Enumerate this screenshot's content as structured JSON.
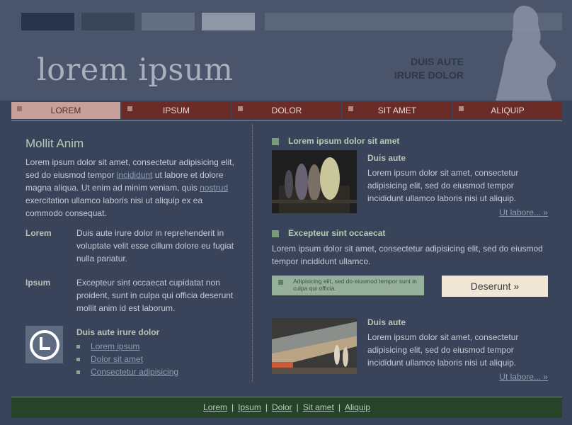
{
  "header": {
    "logo": "lorem ipsum",
    "tagline_line1": "DUIS AUTE",
    "tagline_line2": "IRURE DOLOR"
  },
  "nav": {
    "items": [
      "LOREM",
      "IPSUM",
      "DOLOR",
      "SIT AMET",
      "ALIQUIP"
    ],
    "active_index": 0
  },
  "main": {
    "title": "Mollit Anim",
    "intro": {
      "part1": "Lorem ipsum dolor sit amet, consectetur adipisicing elit, sed do eiusmod tempor",
      "link1": "incididunt",
      "part2": "ut labore et dolore magna aliqua. Ut enim ad minim veniam, quis",
      "link2": "nostrud",
      "part3": "exercitation ullamco laboris nisi ut aliquip ex ea commodo consequat."
    },
    "definitions": [
      {
        "term": "Lorem",
        "desc": "Duis aute irure dolor in reprehenderit in voluptate velit esse cillum dolore eu fugiat nulla pariatur."
      },
      {
        "term": "Ipsum",
        "desc": "Excepteur sint occaecat cupidatat non proident, sunt in culpa qui officia deserunt mollit anim id est laborum."
      }
    ],
    "clock_box": {
      "title": "Duis aute irure dolor",
      "links": [
        "Lorem ipsum",
        "Dolor sit amet",
        "Consectetur adipisicing"
      ]
    }
  },
  "side": {
    "section1": {
      "heading": "Lorem ipsum dolor sit amet",
      "article": {
        "title": "Duis aute",
        "text": "Lorem ipsum dolor sit amet, consectetur adipisicing elit, sed do eiusmod tempor incididunt ullamco laboris nisi ut aliquip.",
        "more": "Ut labore... »"
      }
    },
    "section2": {
      "heading": "Excepteur sint occaecat",
      "text": "Lorem ipsum dolor sit amet, consectetur adipisicing elit, sed do eiusmod tempor incididunt ullamco."
    },
    "notice": "Adipisicing elit, sed do eiusmod tempor sunt in culpa qui officia.",
    "button": "Deserunt »",
    "section3": {
      "article": {
        "title": "Duis aute",
        "text": "Lorem ipsum dolor sit amet, consectetur adipisicing elit, sed do eiusmod tempor incididunt ullamco laboris nisi ut aliquip.",
        "more": "Ut labore... »"
      }
    }
  },
  "footer": {
    "links": [
      "Lorem",
      "Ipsum",
      "Dolor",
      "Sit amet",
      "Aliquip"
    ]
  },
  "colors": {
    "background": "#39435a",
    "header": "#4a556b",
    "nav": "#6b2c28",
    "nav_active": "#c7a09b",
    "accent_green": "#7c9a7e",
    "footer": "#254428",
    "button": "#f1e7d6"
  }
}
